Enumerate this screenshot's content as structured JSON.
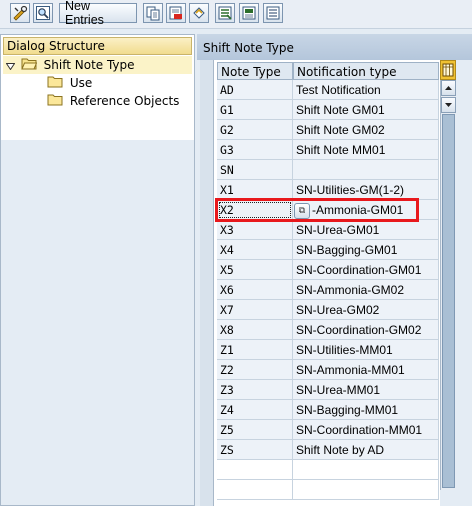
{
  "toolbar": {
    "new_entries_label": "New Entries",
    "icons": [
      "change-display-icon",
      "details-icon",
      "new-entries",
      "copy-icon",
      "delete-icon",
      "undo-icon",
      "select-all-icon",
      "select-block-icon",
      "deselect-all-icon"
    ]
  },
  "dialog_structure": {
    "header": "Dialog Structure",
    "items": [
      {
        "label": "Shift Note Type",
        "selected": true,
        "expanded": true
      },
      {
        "label": "Use"
      },
      {
        "label": "Reference Objects"
      }
    ]
  },
  "table": {
    "title": "Shift Note Type",
    "columns": [
      "Note Type",
      "Notification type"
    ],
    "rows": [
      {
        "note_type": "AD",
        "notification_type": "Test Notification"
      },
      {
        "note_type": "G1",
        "notification_type": "Shift Note GM01"
      },
      {
        "note_type": "G2",
        "notification_type": "Shift Note GM02"
      },
      {
        "note_type": "G3",
        "notification_type": "Shift Note MM01"
      },
      {
        "note_type": "SN",
        "notification_type": ""
      },
      {
        "note_type": "X1",
        "notification_type": "SN-Utilities-GM(1-2)"
      },
      {
        "note_type": "X2",
        "notification_type": "-Ammonia-GM01"
      },
      {
        "note_type": "X3",
        "notification_type": "SN-Urea-GM01"
      },
      {
        "note_type": "X4",
        "notification_type": "SN-Bagging-GM01"
      },
      {
        "note_type": "X5",
        "notification_type": "SN-Coordination-GM01"
      },
      {
        "note_type": "X6",
        "notification_type": "SN-Ammonia-GM02"
      },
      {
        "note_type": "X7",
        "notification_type": "SN-Urea-GM02"
      },
      {
        "note_type": "X8",
        "notification_type": "SN-Coordination-GM02"
      },
      {
        "note_type": "Z1",
        "notification_type": "SN-Utilities-MM01"
      },
      {
        "note_type": "Z2",
        "notification_type": "SN-Ammonia-MM01"
      },
      {
        "note_type": "Z3",
        "notification_type": "SN-Urea-MM01"
      },
      {
        "note_type": "Z4",
        "notification_type": "SN-Bagging-MM01"
      },
      {
        "note_type": "Z5",
        "notification_type": "SN-Coordination-MM01"
      },
      {
        "note_type": "ZS",
        "notification_type": "Shift Note by AD"
      },
      {
        "note_type": "",
        "notification_type": ""
      },
      {
        "note_type": "",
        "notification_type": ""
      }
    ],
    "highlighted_row": "X2"
  }
}
